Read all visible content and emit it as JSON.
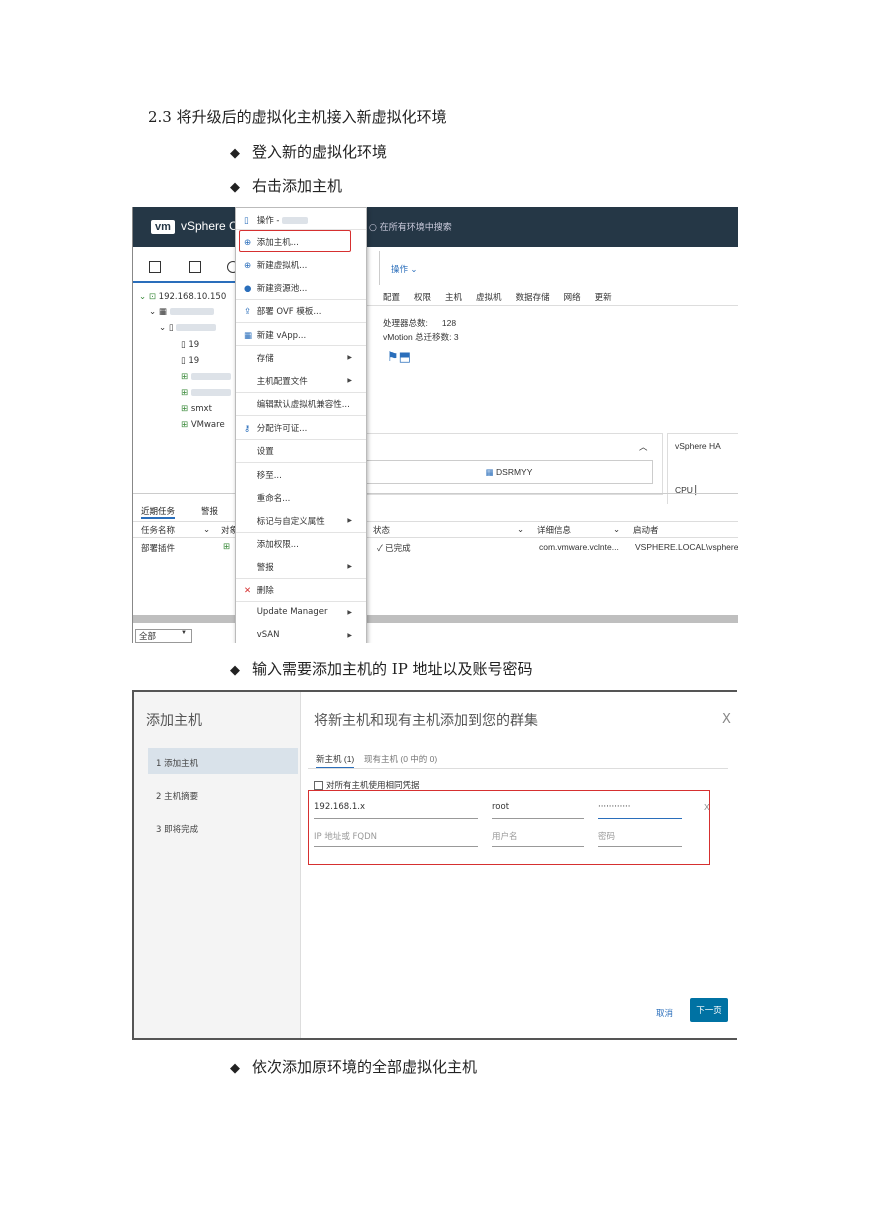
{
  "heading": "2.3 将升级后的虚拟化主机接入新虚拟化环境",
  "bullets": [
    "登入新的虚拟化环境",
    "右击添加主机",
    "输入需要添加主机的 IP 地址以及账号密码",
    "依次添加原环境的全部虚拟化主机"
  ],
  "bullet_symbol": "◆",
  "shot1": {
    "logo": "vm",
    "app_title": "vSphere C",
    "search_placeholder": "在所有环境中搜索",
    "actions_label": "操作 ⌄",
    "tabs": [
      "配置",
      "权限",
      "主机",
      "虚拟机",
      "数据存储",
      "网络",
      "更新"
    ],
    "tree": [
      "192.168.10.150",
      "19",
      "19",
      "smxt",
      "VMware"
    ],
    "info": {
      "cpu_total_label": "处理器总数:",
      "cpu_total": "128",
      "vmotion_label": "vMotion 总迁移数:",
      "vmotion": "3"
    },
    "datastore": "DSRMYY",
    "ha_label": "vSphere HA",
    "cpu_label": "CPU",
    "task_tabs": [
      "近期任务",
      "警报"
    ],
    "task_cols": [
      "任务名称",
      "对象",
      "状态",
      "详细信息",
      "启动者"
    ],
    "task_row": {
      "name": "部署插件",
      "status": "✓ 已完成",
      "detail": "com.vmware.vclnte...",
      "initiator": "VSPHERE.LOCAL\\vsphere-"
    },
    "filter": "全部",
    "menu": {
      "header": "操作 -",
      "items": [
        "添加主机...",
        "新建虚拟机...",
        "新建资源池...",
        "部署 OVF 模板...",
        "新建 vApp...",
        "存储",
        "主机配置文件",
        "编辑默认虚拟机兼容性...",
        "分配许可证...",
        "设置",
        "移至...",
        "重命名...",
        "标记与自定义属性",
        "添加权限...",
        "警报",
        "删除",
        "Update Manager",
        "vSAN"
      ]
    }
  },
  "shot2": {
    "title": "添加主机",
    "main_title": "将新主机和现有主机添加到您的群集",
    "close": "X",
    "steps": [
      "1 添加主机",
      "2 主机摘要",
      "3 即将完成"
    ],
    "tabs": [
      "新主机 (1)",
      "现有主机 (0 中的 0)"
    ],
    "checkbox_label": "对所有主机使用相同凭据",
    "row1": {
      "ip": "192.168.1.x",
      "user": "root",
      "password": "············"
    },
    "row2": {
      "ip": "IP 地址或 FQDN",
      "user": "用户名",
      "password": "密码"
    },
    "remove": "X",
    "cancel": "取消",
    "next": "下一页"
  }
}
